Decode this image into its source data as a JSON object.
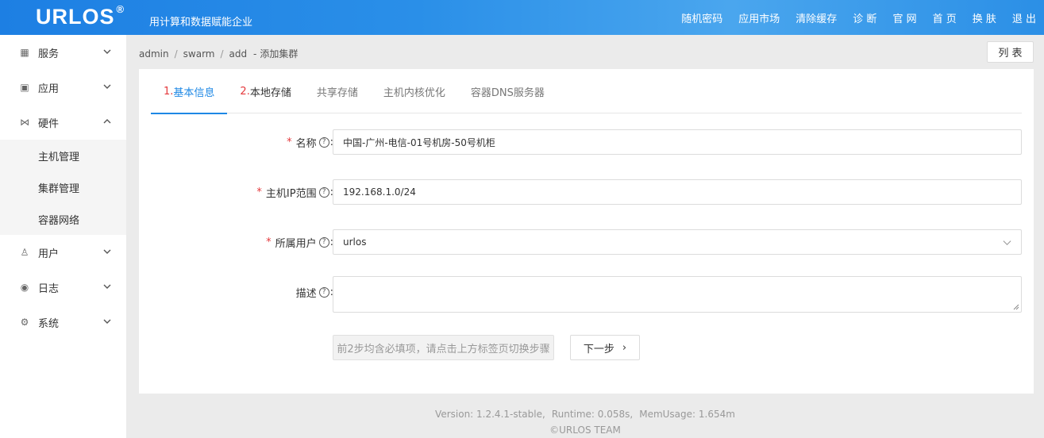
{
  "header": {
    "logo": "URLOS",
    "logo_mark": "®",
    "slogan": "用计算和数据赋能企业",
    "nav": [
      "随机密码",
      "应用市场",
      "清除缓存",
      "诊 断",
      "官 网",
      "首 页",
      "换 肤",
      "退 出"
    ]
  },
  "sidebar": {
    "items": [
      {
        "label": "服务",
        "icon": "grid-icon",
        "glyph": "▦"
      },
      {
        "label": "应用",
        "icon": "apps-icon",
        "glyph": "▣"
      },
      {
        "label": "硬件",
        "icon": "share-icon",
        "glyph": "⋈"
      },
      {
        "label": "用户",
        "icon": "user-icon",
        "glyph": "♙"
      },
      {
        "label": "日志",
        "icon": "eye-icon",
        "glyph": "◉"
      },
      {
        "label": "系统",
        "icon": "gear-icon",
        "glyph": "⚙"
      }
    ],
    "sub_items": [
      "主机管理",
      "集群管理",
      "容器网络"
    ]
  },
  "breadcrumb": {
    "items": [
      "admin",
      "swarm",
      "add"
    ],
    "sep": "/",
    "page": "添加集群",
    "dash": "-"
  },
  "list_button": "列 表",
  "tabs": [
    {
      "num": "1.",
      "label": "基本信息"
    },
    {
      "num": "2.",
      "label": "本地存储"
    },
    {
      "num": "",
      "label": "共享存储"
    },
    {
      "num": "",
      "label": "主机内核优化"
    },
    {
      "num": "",
      "label": "容器DNS服务器"
    }
  ],
  "form": {
    "required_mark": "*",
    "help_mark": "?",
    "colon": ":",
    "name": {
      "label": "名称",
      "value": "中国-广州-电信-01号机房-50号机柜"
    },
    "ip_range": {
      "label": "主机IP范围",
      "value": "192.168.1.0/24"
    },
    "owner": {
      "label": "所属用户",
      "value": "urlos"
    },
    "description": {
      "label": "描述",
      "value": ""
    },
    "hint_button": "前2步均含必填项，请点击上方标签页切换步骤",
    "next_button": "下一步",
    "next_arrow": "›"
  },
  "footer": {
    "version": "Version: 1.2.4.1-stable,",
    "runtime": "Runtime: 0.058s,",
    "mem": "MemUsage: 1.654m",
    "copyright": "©URLOS TEAM"
  },
  "colors": {
    "header": "#1d7fe3",
    "accent": "#1e88e5",
    "required": "#e4393c"
  }
}
